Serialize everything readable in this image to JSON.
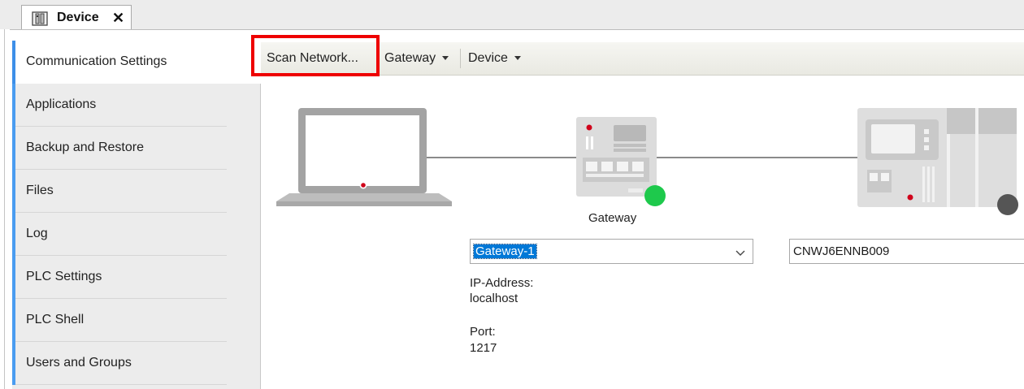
{
  "tab": {
    "title": "Device",
    "icon": "device-icon",
    "close_icon": "close-icon"
  },
  "sidebar": {
    "items": [
      {
        "label": "Communication Settings",
        "active": true
      },
      {
        "label": "Applications"
      },
      {
        "label": "Backup and Restore"
      },
      {
        "label": "Files"
      },
      {
        "label": "Log"
      },
      {
        "label": "PLC Settings"
      },
      {
        "label": "PLC Shell"
      },
      {
        "label": "Users and Groups"
      }
    ]
  },
  "toolbar": {
    "scan_label": "Scan Network...",
    "gateway_label": "Gateway",
    "device_label": "Device"
  },
  "diagram": {
    "gateway_caption": "Gateway",
    "gateway_select": "Gateway-1",
    "device_field": "CNWJ6ENNB009",
    "gateway_status_color": "#1ec94c",
    "device_status_color": "#555555",
    "ip_label": "IP-Address:",
    "ip_value": "localhost",
    "port_label": "Port:",
    "port_value": "1217"
  },
  "colors": {
    "accent": "#4a9cf0",
    "highlight": "#ee0000",
    "status_led": "#d0021b"
  }
}
